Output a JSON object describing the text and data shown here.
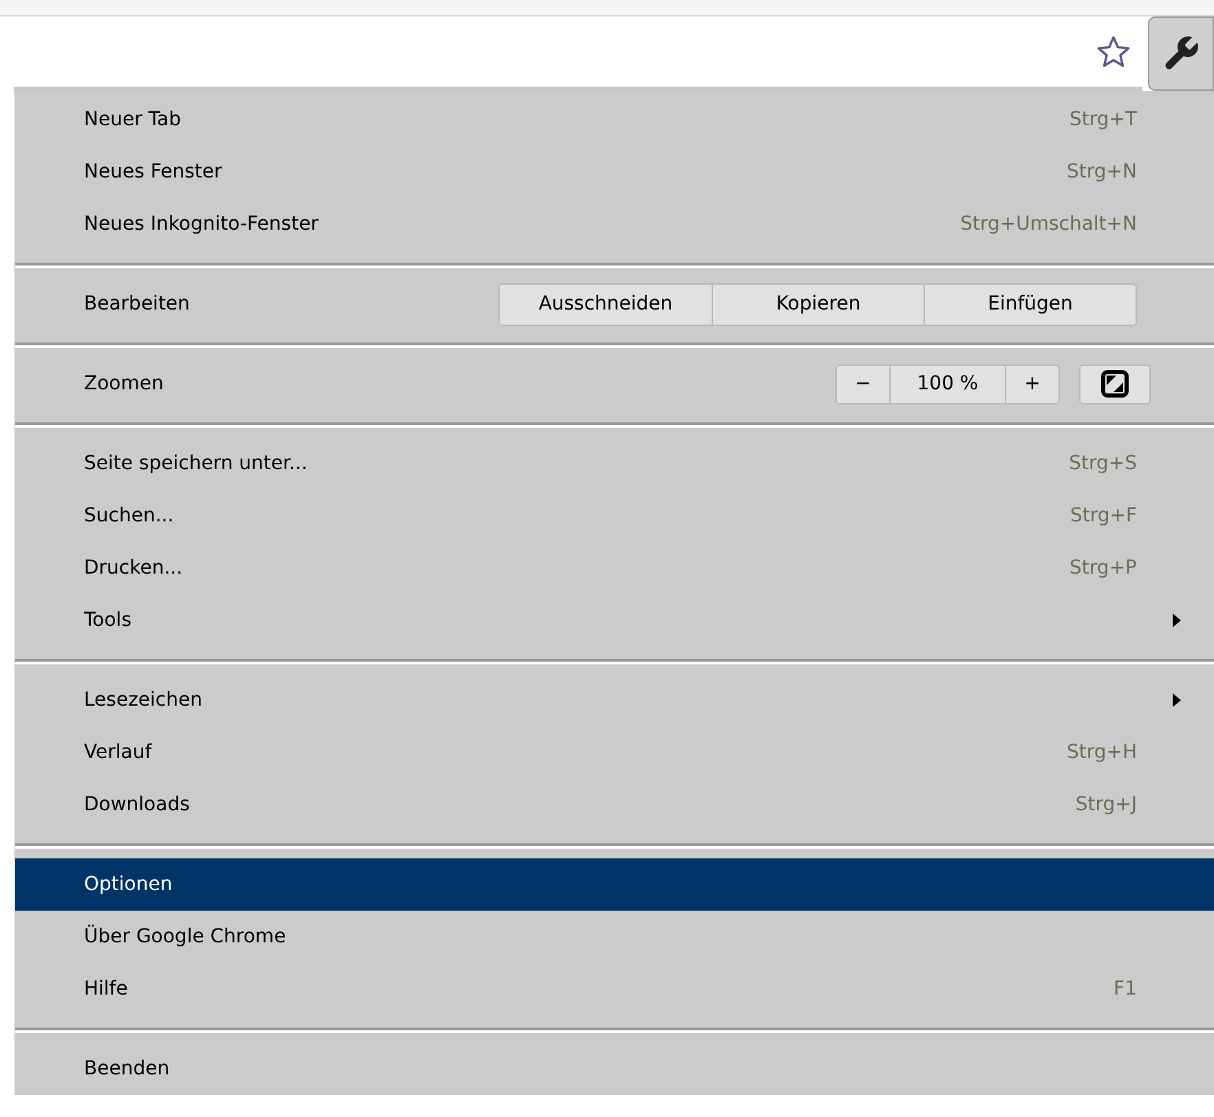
{
  "toolbar": {
    "bookmark_starred": false
  },
  "menu": {
    "groups": [
      {
        "items": [
          {
            "kind": "item",
            "label": "Neuer Tab",
            "shortcut": "Strg+T",
            "selected": false
          },
          {
            "kind": "item",
            "label": "Neues Fenster",
            "shortcut": "Strg+N",
            "selected": false
          },
          {
            "kind": "item",
            "label": "Neues Inkognito-Fenster",
            "shortcut": "Strg+Umschalt+N",
            "selected": false
          }
        ]
      },
      {
        "items": [
          {
            "kind": "edit",
            "label": "Bearbeiten",
            "buttons": [
              "Ausschneiden",
              "Kopieren",
              "Einfügen"
            ]
          }
        ]
      },
      {
        "items": [
          {
            "kind": "zoom",
            "label": "Zoomen",
            "minus": "−",
            "value": "100 %",
            "plus": "+"
          }
        ]
      },
      {
        "items": [
          {
            "kind": "item",
            "label": "Seite speichern unter...",
            "shortcut": "Strg+S",
            "selected": false
          },
          {
            "kind": "item",
            "label": "Suchen...",
            "shortcut": "Strg+F",
            "selected": false
          },
          {
            "kind": "item",
            "label": "Drucken...",
            "shortcut": "Strg+P",
            "selected": false
          },
          {
            "kind": "item",
            "label": "Tools",
            "submenu": true,
            "selected": false
          }
        ]
      },
      {
        "items": [
          {
            "kind": "item",
            "label": "Lesezeichen",
            "submenu": true,
            "selected": false
          },
          {
            "kind": "item",
            "label": "Verlauf",
            "shortcut": "Strg+H",
            "selected": false
          },
          {
            "kind": "item",
            "label": "Downloads",
            "shortcut": "Strg+J",
            "selected": false
          }
        ]
      },
      {
        "items": [
          {
            "kind": "item",
            "label": "Optionen",
            "selected": true
          },
          {
            "kind": "item",
            "label": "Über Google Chrome",
            "selected": false
          },
          {
            "kind": "item",
            "label": "Hilfe",
            "shortcut": "F1",
            "selected": false
          }
        ]
      },
      {
        "items": [
          {
            "kind": "item",
            "label": "Beenden",
            "selected": false
          }
        ]
      }
    ]
  }
}
